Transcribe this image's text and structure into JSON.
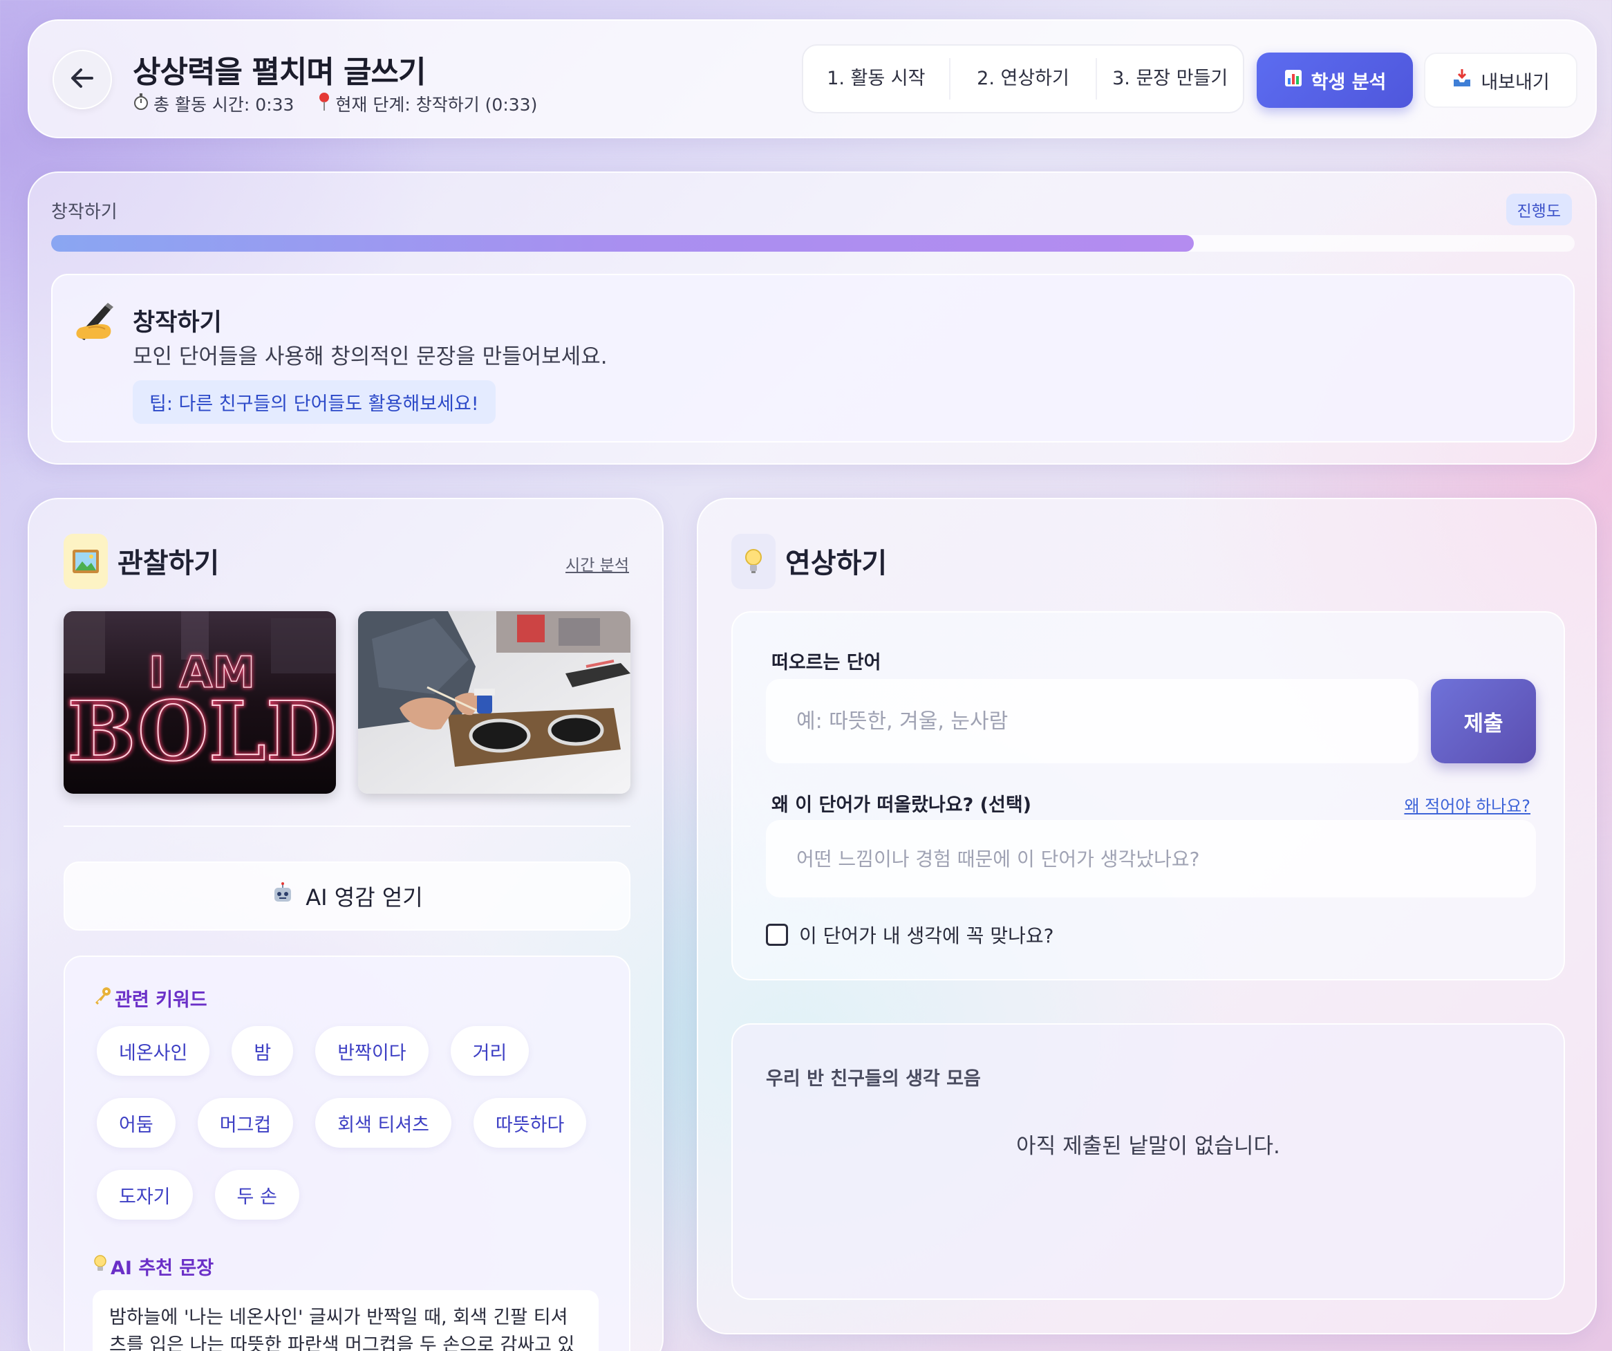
{
  "header": {
    "title": "상상력을 펼치며 글쓰기",
    "total_time": "총 활동 시간: 0:33",
    "current_stage": "현재 단계: 창작하기 (0:33)",
    "steps": [
      "1. 활동 시작",
      "2. 연상하기",
      "3. 문장 만들기"
    ],
    "analysis_label": "학생 분석",
    "export_label": "내보내기"
  },
  "progress": {
    "label": "창작하기",
    "badge": "진행도",
    "fraction": 0.75
  },
  "stage": {
    "title": "창작하기",
    "description": "모인 단어들을 사용해 창의적인 문장을 만들어보세요.",
    "tip": "팁: 다른 친구들의 단어들도 활용해보세요!"
  },
  "observe": {
    "title": "관찰하기",
    "time_link": "시간 분석",
    "neon_text": [
      "I AM",
      "BOLD"
    ],
    "ai_button": "AI 영감 얻기",
    "keywords_heading": "관련 키워드",
    "keywords": [
      "네온사인",
      "밤",
      "반짝이다",
      "거리",
      "어둠",
      "머그컵",
      "회색 티셔츠",
      "따뜻하다",
      "도자기",
      "두 손"
    ],
    "sentence_heading": "AI 추천 문장",
    "sentence": "밤하늘에 '나는 네온사인' 글씨가 반짝일 때, 회색 긴팔 티셔츠를 입은 나는 따뜻한 파란색 머그컵을 두 손으로 감싸고 있었어."
  },
  "associate": {
    "title": "연상하기",
    "word_label": "떠오르는 단어",
    "word_placeholder": "예: 따뜻한, 겨울, 눈사람",
    "submit_label": "제출",
    "reason_label": "왜 이 단어가 떠올랐나요? (선택)",
    "why_link": "왜 적어야 하나요?",
    "reason_placeholder": "어떤 느낌이나 경험 때문에 이 단어가 생각났나요?",
    "check_label": "이 단어가 내 생각에 꼭 맞나요?",
    "collection_title": "우리 반 친구들의 생각 모음",
    "empty_message": "아직 제출된 낱말이 없습니다."
  },
  "icons": {
    "back": "arrow-left-icon",
    "timer": "stopwatch-icon",
    "pin": "pin-icon",
    "chart": "bar-chart-icon",
    "export": "inbox-tray-icon",
    "writing": "writing-hand-icon",
    "picture": "framed-picture-icon",
    "bulb": "light-bulb-icon",
    "robot": "robot-icon",
    "key": "key-icon"
  },
  "colors": {
    "accent": "#5c6cf0",
    "submit": "#6f72d9",
    "keyword_text": "#3d3fc4",
    "heading_purple": "#6a2fc7",
    "neon": "#ff3f6e"
  }
}
